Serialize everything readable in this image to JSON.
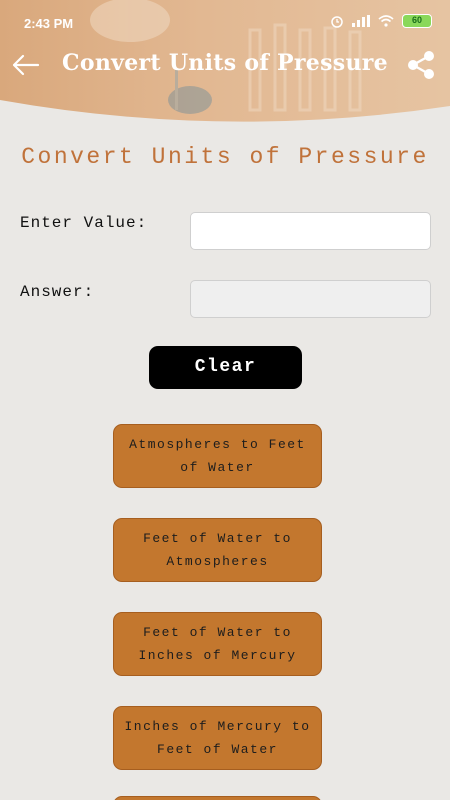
{
  "status_bar": {
    "time": "2:43 PM",
    "battery": "60"
  },
  "toolbar": {
    "title": "Convert Units of Pressure",
    "back_icon": "back-arrow-icon",
    "share_icon": "share-icon"
  },
  "main": {
    "heading": "Convert Units of Pressure",
    "value_label": "Enter Value:",
    "value_input": "",
    "answer_label": "Answer:",
    "answer_value": "",
    "clear_label": "Clear",
    "conversions": [
      "Atmospheres to Feet of Water",
      "Feet of Water to Atmospheres",
      "Feet of Water to Inches of Mercury",
      "Inches of Mercury to Feet of Water"
    ]
  },
  "colors": {
    "accent": "#c3772e",
    "heading": "#c0723a",
    "background": "#eae8e5"
  }
}
